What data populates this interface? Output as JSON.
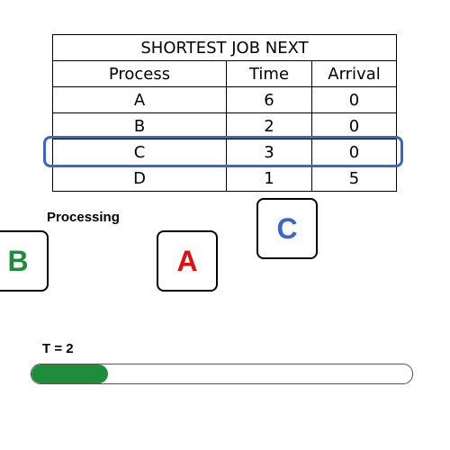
{
  "table": {
    "title": "SHORTEST JOB NEXT",
    "headers": [
      "Process",
      "Time",
      "Arrival"
    ],
    "rows": [
      [
        "A",
        "6",
        "0"
      ],
      [
        "B",
        "2",
        "0"
      ],
      [
        "C",
        "3",
        "0"
      ],
      [
        "D",
        "1",
        "5"
      ]
    ],
    "highlighted_row": "C",
    "highlight_color": "#3a66c4"
  },
  "processing_label": "Processing",
  "jobs": {
    "processing": {
      "label": "B",
      "color": "#1e8c3a"
    },
    "waiting_a": {
      "label": "A",
      "color": "#e01010"
    },
    "waiting_c": {
      "label": "C",
      "color": "#3a66c4"
    }
  },
  "timer": {
    "label": "T = 2",
    "progress_fraction": 0.2,
    "progress_color": "#1e8c3a"
  }
}
